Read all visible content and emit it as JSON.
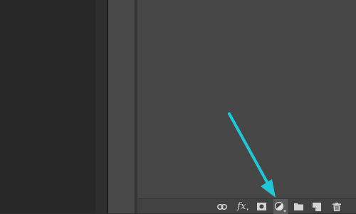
{
  "layers_toolbar": {
    "link_icon": "link-icon",
    "fx_label": "fx",
    "mask_icon": "layer-mask-icon",
    "adjustment_icon": "adjustment-layer-icon",
    "group_icon": "folder-icon",
    "new_layer_icon": "new-layer-icon",
    "delete_icon": "trash-icon"
  },
  "annotation": {
    "arrow_color": "#1ec8d8",
    "target": "adjustment-layer-button"
  },
  "colors": {
    "canvas": "#282828",
    "panel": "#474747",
    "toolbar": "#424242",
    "icon": "#d4d4d4"
  }
}
